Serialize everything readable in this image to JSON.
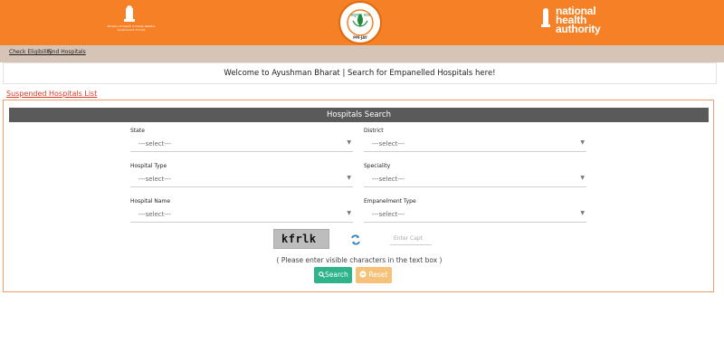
{
  "header": {
    "ministry_text": "Ministry of Health & Family Welfare Government of India",
    "logo_text": "आयुष्मान भारत",
    "logo_subtext": "PM-JAY",
    "nha_lines": [
      "national",
      "health",
      "authority"
    ]
  },
  "nav": {
    "links": [
      "Check Eligibility",
      "Find Hospitals"
    ]
  },
  "welcome_text": "Welcome to Ayushman Bharat | Search for Empanelled Hospitals here!",
  "suspended_link": "Suspended Hospitals List",
  "panel": {
    "title": "Hospitals Search",
    "fields": [
      {
        "label": "State",
        "value": "---select---"
      },
      {
        "label": "District",
        "value": "---select---"
      },
      {
        "label": "Hospital Type",
        "value": "---select---"
      },
      {
        "label": "Speciality",
        "value": "---select---"
      },
      {
        "label": "Hospital Name",
        "value": "---select---"
      },
      {
        "label": "Empanelment Type",
        "value": "---select---"
      }
    ],
    "captcha_text": "kfrlk",
    "captcha_placeholder": "Enter Capt",
    "hint": "( Please enter visible characters in the text box )",
    "search_label": "Search",
    "reset_label": "Reset"
  },
  "colors": {
    "header_bg": "#f58025",
    "nav_bg": "#d6c4b6",
    "search_btn": "#2eb38a",
    "reset_btn": "#f6c178"
  }
}
